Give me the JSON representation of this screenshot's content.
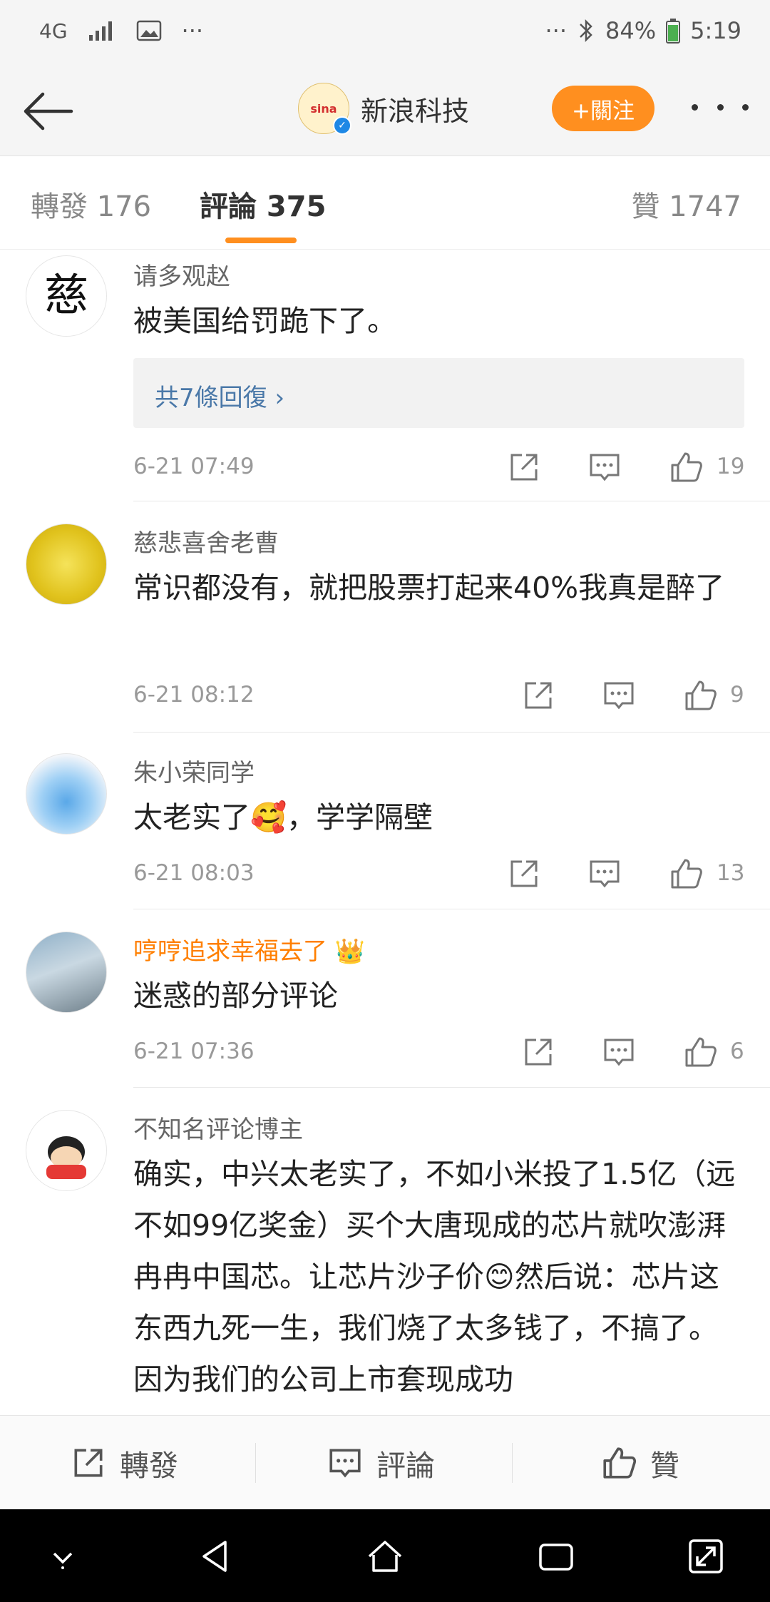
{
  "status_bar": {
    "network": "4G",
    "more": "···",
    "more_right": "···",
    "battery": "84%",
    "time": "5:19"
  },
  "header": {
    "account_name": "新浪科技",
    "avatar_text": "sina",
    "follow_label": "+關注"
  },
  "tabs": [
    {
      "label": "轉發 176"
    },
    {
      "label": "評論 375"
    },
    {
      "label": "贊 1747"
    }
  ],
  "comments": [
    {
      "user": "请多观赵",
      "text": "被美国给罚跪下了。",
      "reply": "共7條回復 ›",
      "time": "6-21 07:49",
      "likes": "19"
    },
    {
      "user": "慈悲喜舍老曹",
      "text": "常识都没有，就把股票打起来40%我真是醉了",
      "time": "6-21 08:12",
      "likes": "9"
    },
    {
      "user": "朱小荣同学",
      "text": "太老实了🥰，学学隔壁",
      "time": "6-21 08:03",
      "likes": "13"
    },
    {
      "user": "哼哼追求幸福去了 👑",
      "text": "迷惑的部分评论",
      "time": "6-21 07:36",
      "likes": "6"
    },
    {
      "user": "不知名评论博主",
      "text": "确实，中兴太老实了，不如小米投了1.5亿（远不如99亿奖金）买个大唐现成的芯片就吹澎湃冉冉中国芯。让芯片沙子价😊然后说：芯片这东西九死一生，我们烧了太多钱了，不搞了。因为我们的公司上市套现成功"
    }
  ],
  "bottom_bar": {
    "repost": "轉發",
    "comment": "評論",
    "like": "贊"
  },
  "colors": {
    "accent": "#ff8f1f",
    "link": "#4a78a8",
    "vip_name": "#ff7f00"
  }
}
